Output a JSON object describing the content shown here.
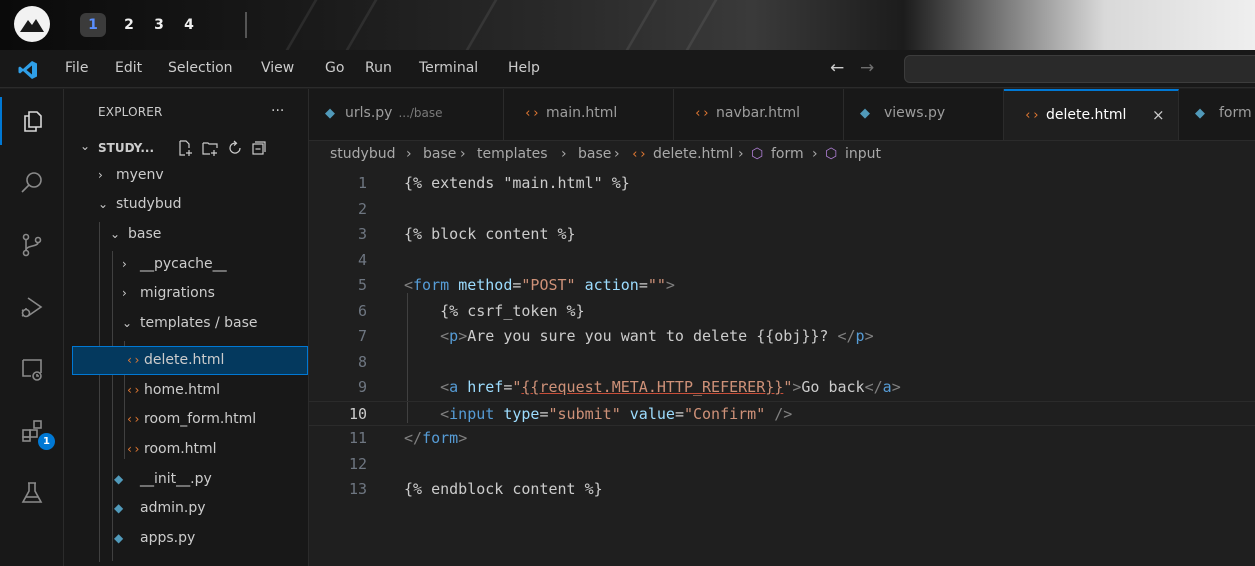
{
  "desktop": {
    "workspaces": [
      "1",
      "2",
      "3",
      "4"
    ],
    "active_workspace": "1"
  },
  "menu": {
    "items": [
      "File",
      "Edit",
      "Selection",
      "View",
      "Go",
      "Run",
      "Terminal",
      "Help"
    ],
    "nav_back": "←",
    "nav_forward": "→"
  },
  "activity_bar": {
    "items": [
      "explorer-icon",
      "search-icon",
      "source-control-icon",
      "run-debug-icon",
      "remote-explorer-icon",
      "extensions-icon",
      "testing-icon"
    ],
    "extensions_badge": "1"
  },
  "sidebar": {
    "title": "EXPLORER",
    "more": "···",
    "workspace_name": "STUDY...",
    "tree": [
      {
        "label": "myenv",
        "type": "folder",
        "expanded": false,
        "depth": 1
      },
      {
        "label": "studybud",
        "type": "folder",
        "expanded": true,
        "depth": 1
      },
      {
        "label": "base",
        "type": "folder",
        "expanded": true,
        "depth": 2
      },
      {
        "label": "__pycache__",
        "type": "folder",
        "expanded": false,
        "depth": 3
      },
      {
        "label": "migrations",
        "type": "folder",
        "expanded": false,
        "depth": 3
      },
      {
        "label": "templates / base",
        "type": "folder",
        "expanded": true,
        "depth": 3
      },
      {
        "label": "delete.html",
        "type": "html",
        "depth": 4,
        "selected": true
      },
      {
        "label": "home.html",
        "type": "html",
        "depth": 4
      },
      {
        "label": "room_form.html",
        "type": "html",
        "depth": 4
      },
      {
        "label": "room.html",
        "type": "html",
        "depth": 4
      },
      {
        "label": "__init__.py",
        "type": "py",
        "depth": 3
      },
      {
        "label": "admin.py",
        "type": "py",
        "depth": 3
      },
      {
        "label": "apps.py",
        "type": "py",
        "depth": 3
      }
    ]
  },
  "tabs": [
    {
      "label": "urls.py",
      "desc": ".../base",
      "type": "py"
    },
    {
      "label": "main.html",
      "type": "html"
    },
    {
      "label": "navbar.html",
      "type": "html"
    },
    {
      "label": "views.py",
      "type": "py"
    },
    {
      "label": "delete.html",
      "type": "html",
      "active": true,
      "close": "×"
    },
    {
      "label": "form",
      "type": "py"
    }
  ],
  "breadcrumb": [
    "studybud",
    "base",
    "templates",
    "base",
    "delete.html",
    "form",
    "input"
  ],
  "editor": {
    "current_line": "10",
    "lines": [
      {
        "n": "1",
        "tokens": [
          [
            "t-tmpl",
            "{% extends \"main.html\" %}"
          ]
        ]
      },
      {
        "n": "2",
        "tokens": []
      },
      {
        "n": "3",
        "tokens": [
          [
            "t-tmpl",
            "{% block content %}"
          ]
        ]
      },
      {
        "n": "4",
        "tokens": []
      },
      {
        "n": "5",
        "tokens": [
          [
            "t-brk",
            "<"
          ],
          [
            "t-tag",
            "form"
          ],
          [
            "t-text",
            " "
          ],
          [
            "t-attr",
            "method"
          ],
          [
            "t-text",
            "="
          ],
          [
            "t-str",
            "\"POST\""
          ],
          [
            "t-text",
            " "
          ],
          [
            "t-attr",
            "action"
          ],
          [
            "t-text",
            "="
          ],
          [
            "t-str",
            "\"\""
          ],
          [
            "t-brk",
            ">"
          ]
        ]
      },
      {
        "n": "6",
        "tokens": [
          [
            "t-text",
            "    "
          ],
          [
            "t-tmpl",
            "{% csrf_token %}"
          ]
        ]
      },
      {
        "n": "7",
        "tokens": [
          [
            "t-text",
            "    "
          ],
          [
            "t-brk",
            "<"
          ],
          [
            "t-tag",
            "p"
          ],
          [
            "t-brk",
            ">"
          ],
          [
            "t-text",
            "Are you sure you want to delete {{obj}}? "
          ],
          [
            "t-brk",
            "</"
          ],
          [
            "t-tag",
            "p"
          ],
          [
            "t-brk",
            ">"
          ]
        ]
      },
      {
        "n": "8",
        "tokens": []
      },
      {
        "n": "9",
        "tokens": [
          [
            "t-text",
            "    "
          ],
          [
            "t-brk",
            "<"
          ],
          [
            "t-tag",
            "a"
          ],
          [
            "t-text",
            " "
          ],
          [
            "t-attr",
            "href"
          ],
          [
            "t-text",
            "="
          ],
          [
            "t-str",
            "\""
          ],
          [
            "t-str t-ul",
            "{{request.META.HTTP_REFERER}}"
          ],
          [
            "t-str",
            "\""
          ],
          [
            "t-brk",
            ">"
          ],
          [
            "t-text",
            "Go back"
          ],
          [
            "t-brk",
            "</"
          ],
          [
            "t-tag",
            "a"
          ],
          [
            "t-brk",
            ">"
          ]
        ]
      },
      {
        "n": "10",
        "tokens": [
          [
            "t-text",
            "    "
          ],
          [
            "t-brk",
            "<"
          ],
          [
            "t-tag",
            "input"
          ],
          [
            "t-text",
            " "
          ],
          [
            "t-attr",
            "type"
          ],
          [
            "t-text",
            "="
          ],
          [
            "t-str",
            "\"submit\""
          ],
          [
            "t-text",
            " "
          ],
          [
            "t-attr",
            "value"
          ],
          [
            "t-text",
            "="
          ],
          [
            "t-str",
            "\"Confirm\""
          ],
          [
            "t-text",
            " "
          ],
          [
            "t-brk",
            "/>"
          ]
        ]
      },
      {
        "n": "11",
        "tokens": [
          [
            "t-brk",
            "</"
          ],
          [
            "t-tag",
            "form"
          ],
          [
            "t-brk",
            ">"
          ]
        ]
      },
      {
        "n": "12",
        "tokens": []
      },
      {
        "n": "13",
        "tokens": [
          [
            "t-tmpl",
            "{% endblock content %}"
          ]
        ]
      }
    ]
  },
  "colors": {
    "accent": "#0078d4",
    "html_icon": "#e37933",
    "py_icon": "#519aba",
    "selection": "#04395e"
  }
}
